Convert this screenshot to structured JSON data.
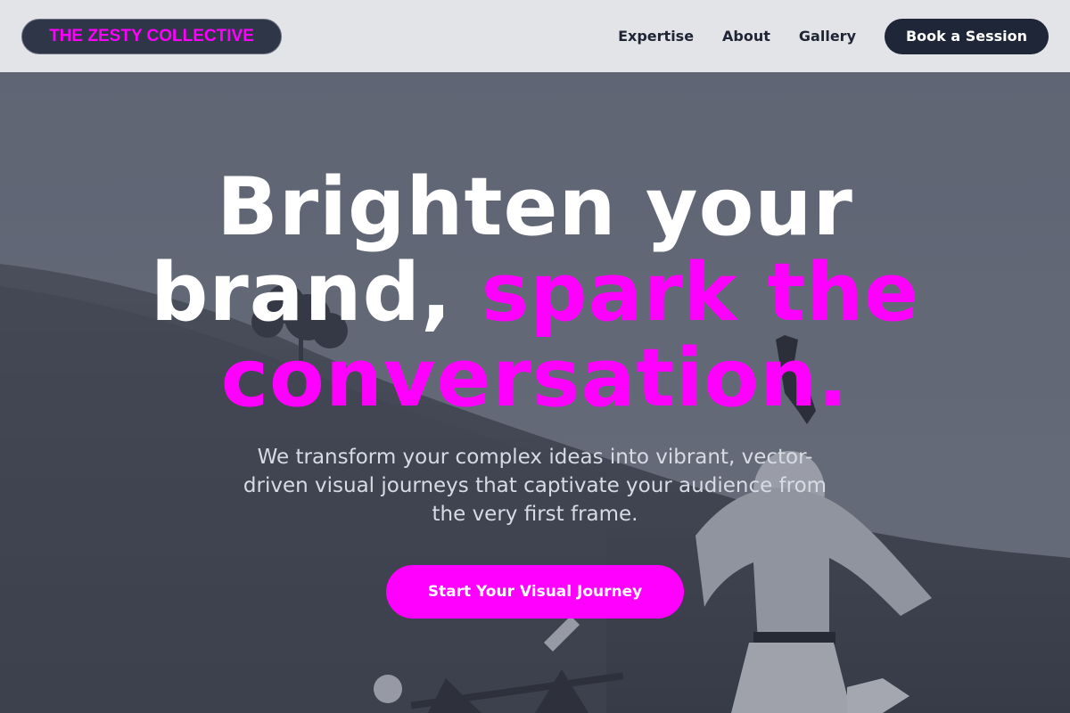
{
  "brand": {
    "name": "THE ZESTY COLLECTIVE"
  },
  "nav": {
    "items": [
      {
        "label": "Expertise"
      },
      {
        "label": "About"
      },
      {
        "label": "Gallery"
      }
    ],
    "cta_label": "Book a Session"
  },
  "hero": {
    "headline_part1": "Brighten your brand, ",
    "headline_accent": "spark the conversation.",
    "subtext": "We transform your complex ideas into vibrant, vector-driven visual journeys that captivate your audience from the very first frame.",
    "cta_label": "Start Your Visual Journey",
    "background_image": "person-jumping-on-hillside-photo"
  },
  "colors": {
    "accent": "#ff00ff",
    "navy": "#1e2637",
    "topbar_bg": "#e3e4e7"
  }
}
